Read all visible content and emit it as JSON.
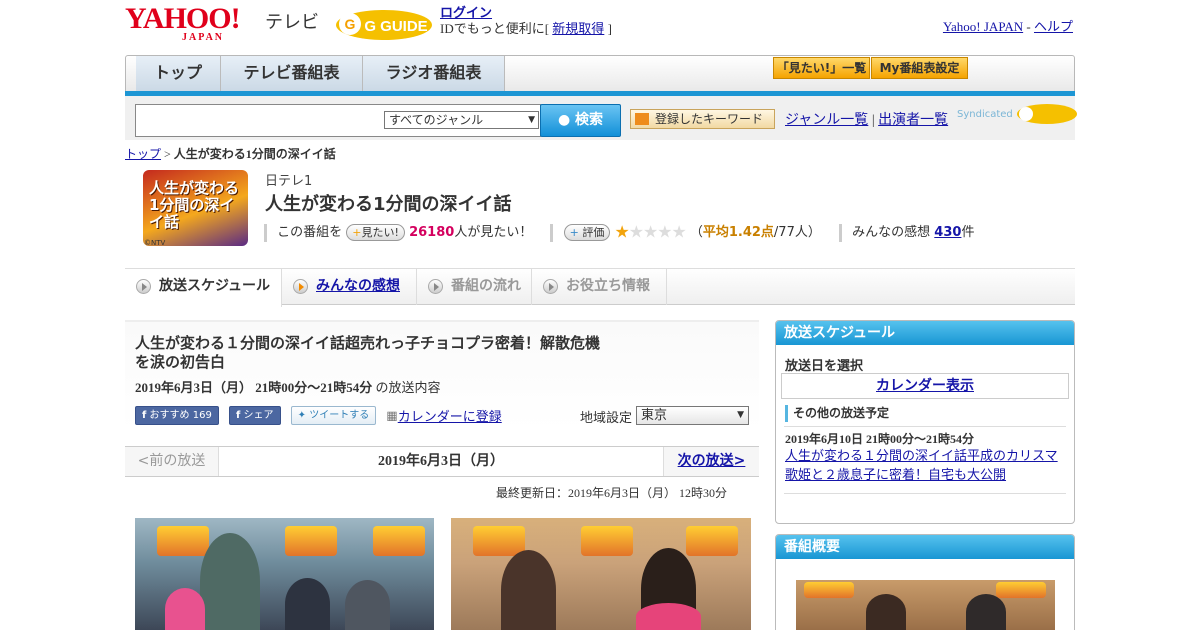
{
  "header": {
    "brand": "YAHOO!",
    "brand_sub": "JAPAN",
    "service": "テレビ",
    "gguide_logo_text": "G GUIDE",
    "login": "ログイン",
    "id_text": "IDでもっと便利に[",
    "signup": "新規取得",
    "id_close": "]",
    "yahoo_japan": "Yahoo! JAPAN",
    "separator": "-",
    "help": "ヘルプ"
  },
  "nav": {
    "tabs": [
      "トップ",
      "テレビ番組表",
      "ラジオ番組表"
    ],
    "mitai_list": "「見たい!」一覧",
    "my_schedule": "My番組表設定"
  },
  "search": {
    "genre_selected": "すべてのジャンル",
    "button": "検索",
    "keyword_button": "登録したキーワード",
    "genre_list": "ジャンル一覧",
    "divider": "|",
    "cast_list": "出演者一覧",
    "syndicated": "Syndicated"
  },
  "breadcrumb": {
    "top": "トップ",
    "sep": ">",
    "current": "人生が変わる1分間の深イイ話"
  },
  "program": {
    "logo_text": "人生が変わる1分間の深イイ話",
    "copyright": "©NTV",
    "channel": "日テレ1",
    "title": "人生が変わる1分間の深イイ話",
    "this_program": "この番組を",
    "mitai_btn": "見たい!",
    "want_count": "26180",
    "want_suffix": "人が見たい！",
    "rate_btn": "評価",
    "rating_stars": 1,
    "rating_max": 5,
    "avg_open": "（",
    "avg_label": "平均1.42点",
    "avg_count": "/77人）",
    "impressions_label": "みんなの感想",
    "impressions_count": "430",
    "impressions_suffix": "件"
  },
  "tabs": [
    {
      "label": "放送スケジュール",
      "state": "active"
    },
    {
      "label": "みんなの感想",
      "state": "link"
    },
    {
      "label": "番組の流れ",
      "state": "disabled"
    },
    {
      "label": "お役立ち情報",
      "state": "disabled"
    }
  ],
  "broadcast": {
    "title": "人生が変わる１分間の深イイ話超売れっ子チョコプラ密着！解散危機を涙の初告白",
    "datetime": "2019年6月3日（月） 21時00分～21時54分",
    "datetime_suffix": "の放送内容",
    "fb_recommend": "おすすめ",
    "fb_count": "169",
    "fb_share": "シェア",
    "tweet": "ツイートする",
    "calendar_register": "カレンダーに登録",
    "region_label": "地域設定",
    "region_value": "東京",
    "prev": "<前の放送",
    "current_date": "2019年6月3日（月）",
    "next": "次の放送>",
    "updated": "最終更新日：2019年6月3日（月） 12時30分"
  },
  "sidebar": {
    "schedule_head": "放送スケジュール",
    "select_date": "放送日を選択",
    "calendar": "カレンダー表示",
    "other_head": "その他の放送予定",
    "other_time": "2019年6月10日 21時00分～21時54分",
    "other_title": "人生が変わる１分間の深イイ話平成のカリスマ歌姫と２歳息子に密着！自宅も大公開",
    "summary_head": "番組概要"
  },
  "colors": {
    "accent_blue": "#1d96d4",
    "link": "#1515a8",
    "pink": "#d4005e",
    "star": "#f2a40d",
    "yahoo_red": "#e0001b"
  }
}
